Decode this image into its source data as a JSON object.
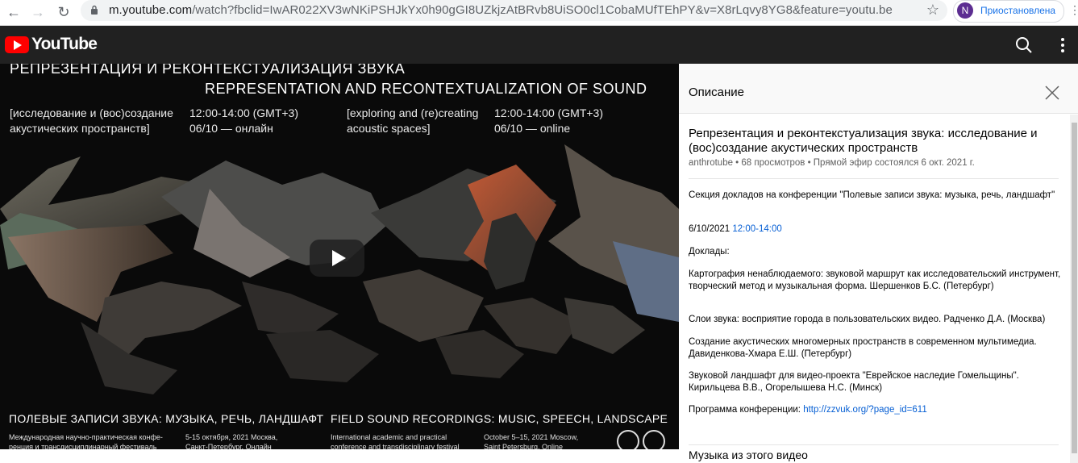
{
  "browser": {
    "url_host": "m.youtube.com",
    "url_rest": "/watch?fbclid=IwAR022XV3wNKiPSHJkYx0h90gGI8UZkjzAtBRvb8UiSO0cl1CobaMUfTEhPY&v=X8rLqvy8YG8&feature=youtu.be",
    "profile_initial": "N",
    "profile_status": "Приостановлена"
  },
  "youtube": {
    "logo_text": "YouTube"
  },
  "video": {
    "title_ru": "РЕПРЕЗЕНТАЦИЯ И РЕКОНТЕКСТУАЛИЗАЦИЯ ЗВУКА",
    "title_en": "REPRESENTATION AND RECONTEXTUALIZATION OF SOUND",
    "ru_sub_1": "[исследование и (вос)создание",
    "ru_sub_2": "акустических пространств]",
    "ru_time": "12:00-14:00 (GMT+3)",
    "ru_date": "06/10 — онлайн",
    "en_sub_1": "[exploring and (re)creating",
    "en_sub_2": "acoustic spaces]",
    "en_time": "12:00-14:00 (GMT+3)",
    "en_date": "06/10 — online",
    "bottom_ru": "ПОЛЕВЫЕ ЗАПИСИ ЗВУКА: МУЗЫКА, РЕЧЬ, ЛАНДШАФТ",
    "bottom_en": "FIELD SOUND RECORDINGS: MUSIC, SPEECH, LANDSCAPE",
    "tiny_ru_1": "Международная научно-практическая конфе-",
    "tiny_ru_2": "ренция и трансдисциплинарный фестиваль",
    "tiny_ru_3": "5-15 октября, 2021 Москва,",
    "tiny_ru_4": "Санкт-Петербург, Онлайн",
    "tiny_en_1": "International academic and practical",
    "tiny_en_2": "conference and transdisciplinary festival",
    "tiny_en_3": "October 5–15, 2021 Moscow,",
    "tiny_en_4": "Saint Petersburg, Online"
  },
  "panel": {
    "header_title": "Описание",
    "video_title": "Репрезентация и реконтекстуализация звука: исследование и (вос)создание акустических пространств",
    "meta": "anthrotube • 68 просмотров • Прямой эфир состоялся 6 окт. 2021 г.",
    "p1": "Секция докладов на конференции \"Полевые записи звука: музыка, речь, ландшафт\"",
    "p2_date": "6/10/2021",
    "p2_time": "12:00-14:00",
    "p3": "Доклады:",
    "p4": "Картография ненаблюдаемого: звуковой маршрут как исследовательский инструмент, творческий метод и музыкальная форма. Шершенков Б.С. (Петербург)",
    "p5": "Слои звука: восприятие города в пользовательских видео. Радченко Д.А. (Москва)",
    "p6": "Создание акустических многомерных пространств в современном мультимедиа. Давиденкова-Хмара Е.Ш. (Петербург)",
    "p7": "Звуковой ландшафт для видео-проекта \"Еврейское наследие Гомельщины\". Кирильцева В.В., Огорелышева Н.С. (Минск)",
    "p8_label": "Программа конференции:",
    "p8_link": "http://zzvuk.org/?page_id=611",
    "music_heading": "Музыка из этого видео"
  }
}
